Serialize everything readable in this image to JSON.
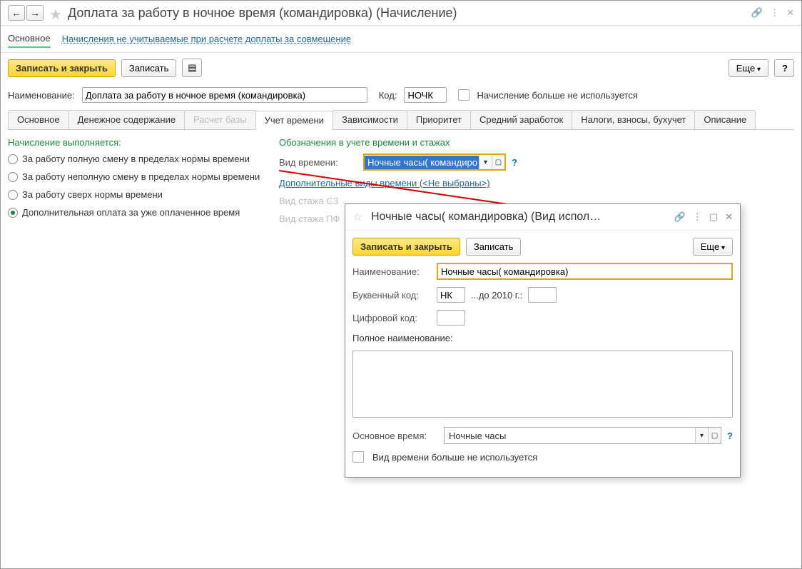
{
  "header": {
    "title": "Доплата за работу в ночное время (командировка) (Начисление)"
  },
  "subnav": {
    "main": "Основное",
    "link": "Начисления не учитываемые при расчете доплаты за совмещение"
  },
  "toolbar": {
    "save_close": "Записать и закрыть",
    "save": "Записать",
    "more": "Еще",
    "help": "?"
  },
  "form": {
    "name_label": "Наименование:",
    "name_value": "Доплата за работу в ночное время (командировка)",
    "code_label": "Код:",
    "code_value": "НОЧК",
    "disabled_label": "Начисление больше не используется"
  },
  "tabs": {
    "t0": "Основное",
    "t1": "Денежное содержание",
    "t2": "Расчет базы",
    "t3": "Учет времени",
    "t4": "Зависимости",
    "t5": "Приоритет",
    "t6": "Средний заработок",
    "t7": "Налоги, взносы, бухучет",
    "t8": "Описание"
  },
  "left": {
    "title": "Начисление выполняется:",
    "r0": "За работу полную смену в пределах нормы времени",
    "r1": "За работу неполную смену в пределах нормы времени",
    "r2": "За работу сверх нормы времени",
    "r3": "Дополнительная оплата за уже оплаченное время"
  },
  "right": {
    "title": "Обозначения в учете времени и стажах",
    "time_type_label": "Вид времени:",
    "time_type_value": "Ночные часы( командиро",
    "add_types_link": "Дополнительные виды времени (<Не выбраны>)",
    "szv_label": "Вид стажа СЗ",
    "pf_label": "Вид стажа ПФ"
  },
  "modal": {
    "title": "Ночные часы( командировка) (Вид испол…",
    "save_close": "Записать и закрыть",
    "save": "Записать",
    "more": "Еще",
    "name_label": "Наименование:",
    "name_value": "Ночные часы( командировка)",
    "letter_label": "Буквенный код:",
    "letter_value": "НК",
    "until_label": "...до 2010 г.:",
    "digit_label": "Цифровой код:",
    "full_label": "Полное наименование:",
    "base_label": "Основное время:",
    "base_value": "Ночные часы",
    "disabled_label": "Вид времени больше не используется"
  }
}
